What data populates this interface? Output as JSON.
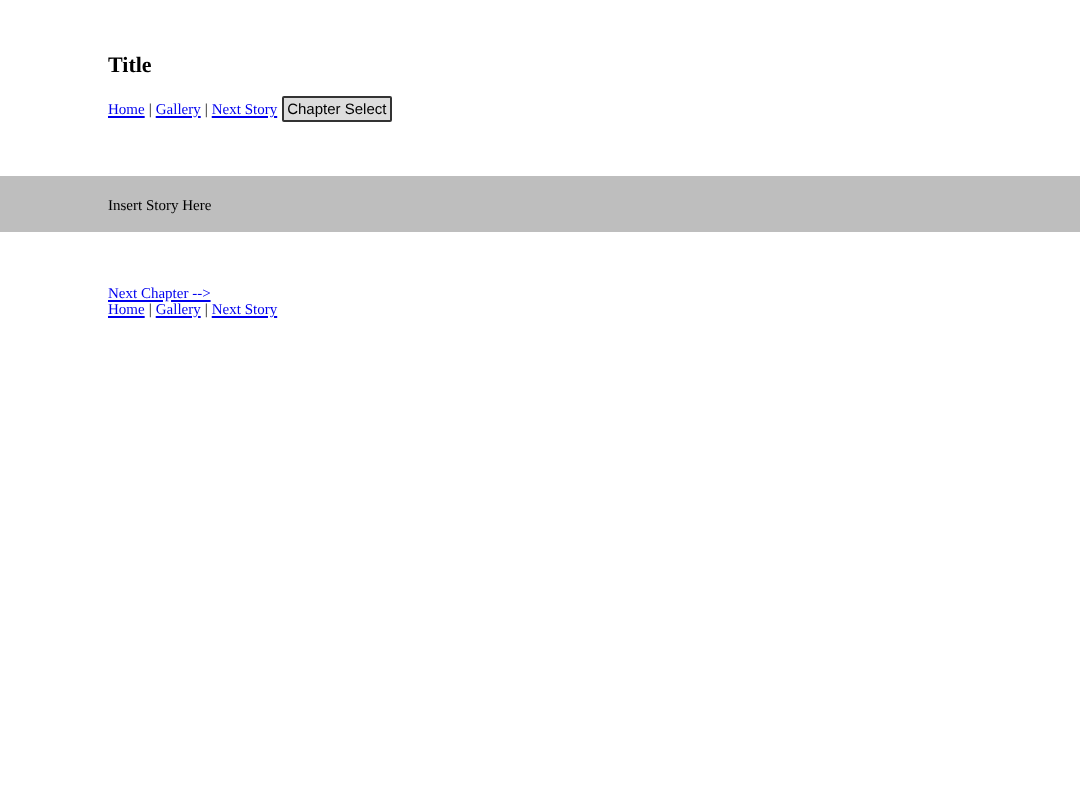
{
  "title": "Title",
  "top_nav": {
    "links": [
      "Home",
      "Gallery",
      "Next Story"
    ],
    "separator": "|",
    "button": "Chapter Select"
  },
  "story": {
    "text": "Insert Story Here"
  },
  "next_chapter": "Next Chapter -->",
  "bottom_nav": {
    "links": [
      "Home",
      "Gallery",
      "Next Story"
    ],
    "separator": "|"
  }
}
